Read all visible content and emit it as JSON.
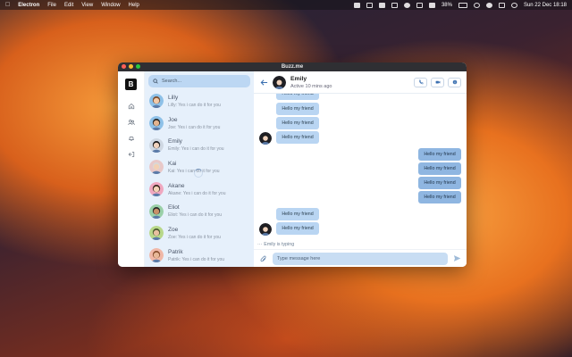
{
  "menubar": {
    "app_name": "Electron",
    "menus": [
      "File",
      "Edit",
      "View",
      "Window",
      "Help"
    ],
    "battery": "38%",
    "datetime": "Sun 22 Dec  18:18"
  },
  "window": {
    "title": "Buzz.me"
  },
  "rail": {
    "logo": "B"
  },
  "search": {
    "placeholder": "Search..."
  },
  "contacts": [
    {
      "name": "Lilly",
      "last_message": "Lilly: Yes i can do it for you",
      "avatar_color": "#f2c9a8",
      "hair": "#7a4a2a",
      "ring": "#8ec1e8"
    },
    {
      "name": "Joe",
      "last_message": "Joe: Yes i can do it for you",
      "avatar_color": "#e3b48f",
      "hair": "#2a2a2a",
      "ring": "#8ec1e8"
    },
    {
      "name": "Emily",
      "last_message": "Emily: Yes i can do it for you",
      "avatar_color": "#f0d2bc",
      "hair": "#1a1a1a",
      "ring": "#cfd8e3"
    },
    {
      "name": "Kai",
      "last_message": "Kai: Yes i can do it for you",
      "avatar_color": "#f2d0b4",
      "hair": "#d8d8d8",
      "ring": "#e8c8c8"
    },
    {
      "name": "Akane",
      "last_message": "Akane: Yes i can do it for you",
      "avatar_color": "#f3d3b8",
      "hair": "#3a2a20",
      "ring": "#f0a8c0"
    },
    {
      "name": "Eliot",
      "last_message": "Eliot: Yes i can do it for you",
      "avatar_color": "#c89068",
      "hair": "#2a2a2a",
      "ring": "#9ad0a8"
    },
    {
      "name": "Zoe",
      "last_message": "Zoe: Yes i can do it for you",
      "avatar_color": "#e8c0a0",
      "hair": "#4a5a30",
      "ring": "#b8d88a"
    },
    {
      "name": "Patrik",
      "last_message": "Patrik: Yes i can do it for you",
      "avatar_color": "#e8b898",
      "hair": "#8a5030",
      "ring": "#f0b8a8"
    }
  ],
  "chat": {
    "name": "Emily",
    "status": "Active 10 mins ago",
    "incoming_text": "Hello my friend",
    "outgoing_text": "Hello my friend",
    "typing": "Emily is typing",
    "composer_placeholder": "Type message here"
  },
  "colors": {
    "accent": "#8fb6e1",
    "sidebar": "#e6f0fb"
  }
}
